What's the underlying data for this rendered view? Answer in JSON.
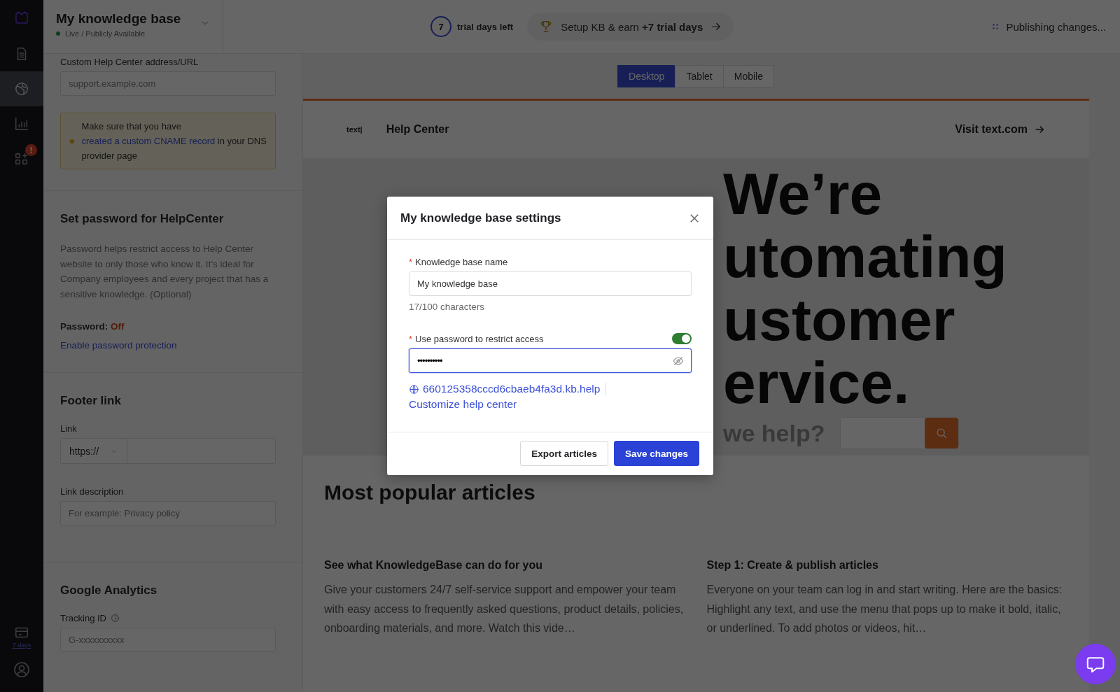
{
  "rail": {
    "items": [
      {
        "kind": "document",
        "selected": false
      },
      {
        "kind": "globe",
        "selected": true
      },
      {
        "kind": "chart",
        "selected": false
      },
      {
        "kind": "apps",
        "selected": false,
        "badge": "!"
      }
    ],
    "trial_link": "7 days"
  },
  "kb_header": {
    "title": "My knowledge base",
    "status": "Live / Publicly Available",
    "live": true
  },
  "top_bar": {
    "trial_days": "7",
    "trial_label": "trial days left",
    "promo": "Setup KB & earn **+7 trial days**",
    "publishing": "Publishing changes..."
  },
  "settings": {
    "custom_url": {
      "label": "Custom Help Center address/URL",
      "placeholder": "support.example.com"
    },
    "warning": {
      "before": "Make sure that you have ",
      "link": "created a custom CNAME record",
      "after": " in your DNS provider page"
    },
    "password_section": {
      "title": "Set password for HelpCenter",
      "description": "Password helps restrict access to Help Center website to only those who know it. It’s ideal for Company employees and every project that has a sensitive knowledge. (Optional)",
      "status_label": "Password:",
      "status_value": "Off",
      "on": false,
      "link": "Enable password protection"
    },
    "footer_link": {
      "title": "Footer link",
      "link_label": "Link",
      "protocol": "https://",
      "description_label": "Link description",
      "description_placeholder": "For example: Privacy policy"
    },
    "analytics": {
      "title": "Google Analytics",
      "tracking_label": "Tracking ID",
      "placeholder": "G-xxxxxxxxxx"
    }
  },
  "preview": {
    "device_tabs": [
      {
        "label": "Desktop",
        "selected": true
      },
      {
        "label": "Tablet",
        "selected": false
      },
      {
        "label": "Mobile",
        "selected": false
      }
    ],
    "site": {
      "logo": "text|",
      "title": "Help Center",
      "visit": "Visit text.com",
      "hero_lines": [
        "We’re",
        "utomating",
        "ustomer",
        "ervice."
      ],
      "search_ghost": "we help?",
      "popular_title": "Most popular articles",
      "articles": [
        {
          "title": "See what KnowledgeBase can do for you",
          "excerpt": "Give your customers 24/7 self-service support and empower your team with easy access to frequently asked questions, product details, policies, onboarding materials, and more. Watch this vide…"
        },
        {
          "title": "Step 1: Create & publish articles",
          "excerpt": "Everyone on your team can log in and start writing. Here are the basics: Highlight any text, and use the menu that pops up to make it bold, italic, or underlined. To add photos or videos, hit…"
        }
      ]
    }
  },
  "modal": {
    "title": "My knowledge base settings",
    "required_mark": "*",
    "name_label": "Knowledge base name",
    "name_value": "My knowledge base",
    "counter": "17/100 characters",
    "password_label": "Use password to restrict access",
    "password_on": true,
    "password_value": "••••••••••",
    "kb_url": "660125358cccd6cbaeb4fa3d.kb.help",
    "customize": "Customize help center",
    "buttons": [
      {
        "label": "Export articles",
        "kind": "secondary"
      },
      {
        "label": "Save changes",
        "kind": "primary"
      }
    ]
  }
}
